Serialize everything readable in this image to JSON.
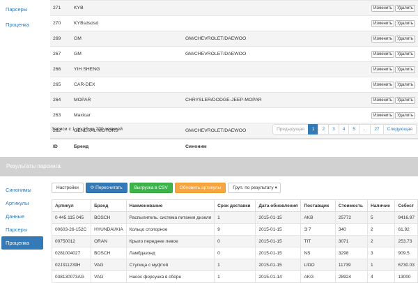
{
  "top_sidebar": [
    "Парсеры",
    "Проценка"
  ],
  "brands": {
    "rows": [
      {
        "id": "271",
        "brand": "KYB",
        "synonym": ""
      },
      {
        "id": "270",
        "brand": "KYBsdsdsd",
        "synonym": ""
      },
      {
        "id": "269",
        "brand": "GM",
        "synonym": "GM/CHEVROLET/DAEWOO"
      },
      {
        "id": "267",
        "brand": "GM",
        "synonym": "GM/CHEVROLET/DAEWOO"
      },
      {
        "id": "266",
        "brand": "YIH SHENG",
        "synonym": ""
      },
      {
        "id": "265",
        "brand": "CAR-DEX",
        "synonym": ""
      },
      {
        "id": "264",
        "brand": "MOPAR",
        "synonym": "CHRYSLER/DODGE-JEEP-MOPAR"
      },
      {
        "id": "263",
        "brand": "Maxicar",
        "synonym": ""
      },
      {
        "id": "262",
        "brand": "GENERAL MOTORS",
        "synonym": "GM/CHEVROLET/DAEWOO"
      }
    ],
    "headers": {
      "id": "ID",
      "brand": "Бренд",
      "synonym": "Синоним"
    },
    "edit_label": "Изменить",
    "delete_label": "Удалить",
    "info": "Записи с 1 до 10 из 270 записей",
    "pager": [
      "Предыдущая",
      "1",
      "2",
      "3",
      "4",
      "5",
      "...",
      "27",
      "Следующая"
    ]
  },
  "results_bar": "Результаты парсинга:",
  "bottom_sidebar": [
    "Синонимы",
    "Артикулы",
    "Данные",
    "Парсеры",
    "Проценка"
  ],
  "toolbar": {
    "settings": "Настройки",
    "recalc": "Пересчитать",
    "export": "Выгрузка в CSV",
    "update": "Обновить артикулы",
    "group": "Груп. по результату"
  },
  "results": {
    "headers": [
      "Артикул",
      "Брэнд",
      "Наименование",
      "Срок доставки",
      "Дата обновления",
      "Поставщик",
      "Стоимость",
      "Наличие",
      "Себест"
    ],
    "rows": [
      [
        "0 445 115 045",
        "BOSCH",
        "Распылитель. система питания дизеля",
        "1",
        "2015-01-15",
        "AKB",
        "25772",
        "5",
        "9416.97"
      ],
      [
        "00603-26-152C",
        "HYUNDAI/KIA",
        "Кольцо стопорное",
        "9",
        "2015-01-15",
        "Э 7",
        "340",
        "2",
        "61.92"
      ],
      [
        "00750012",
        "ORAN",
        "Крыло переднее левое",
        "0",
        "2015-01-15",
        "TIT",
        "3071",
        "2",
        "253.73"
      ],
      [
        "0281004027",
        "BOSCH",
        "Ламбдазонд",
        "0",
        "2015-01-15",
        "NS",
        "3298",
        "3",
        "909.5"
      ],
      [
        "02J311239H",
        "VAG",
        "Ступица с муфтой",
        "1",
        "2015-01-15",
        "LIDO",
        "11739",
        "1",
        "6730.03"
      ],
      [
        "038130073AG",
        "VAG",
        "Насос форсунка в сборе",
        "1",
        "2015-01-14",
        "AKG",
        "28924",
        "4",
        "13000"
      ]
    ]
  }
}
